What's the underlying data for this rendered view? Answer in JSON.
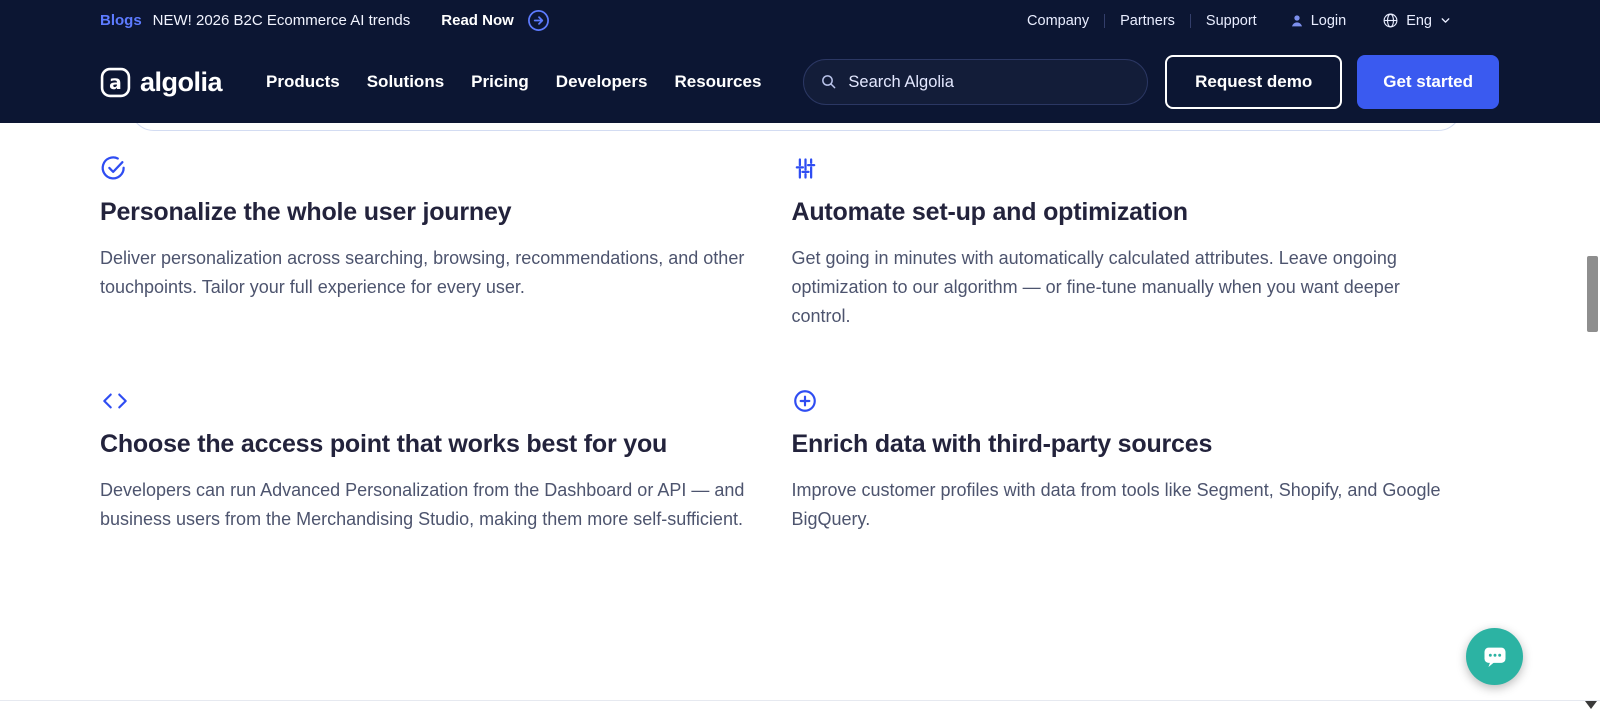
{
  "announcement": {
    "blogs_label": "Blogs",
    "text": "NEW! 2026 B2C Ecommerce AI trends",
    "read_now_label": "Read Now",
    "links": [
      "Company",
      "Partners",
      "Support"
    ],
    "login_label": "Login",
    "language": "Eng"
  },
  "navbar": {
    "brand": "algolia",
    "items": [
      "Products",
      "Solutions",
      "Pricing",
      "Developers",
      "Resources"
    ],
    "search_placeholder": "Search Algolia",
    "request_demo": "Request demo",
    "get_started": "Get started"
  },
  "features": [
    {
      "icon": "check-circle-icon",
      "title": "Personalize the whole user journey",
      "body": "Deliver personalization across searching, browsing, recommendations, and other touchpoints. Tailor your full experience for every user."
    },
    {
      "icon": "sliders-icon",
      "title": "Automate set-up and optimization",
      "body": "Get going in minutes with automatically calculated attributes. Leave ongoing optimization to our algorithm — or fine-tune manually when you want deeper control."
    },
    {
      "icon": "code-icon",
      "title": "Choose the access point that works best for you",
      "body": "Developers can run Advanced Personalization from the Dashboard or API — and business users from the Merchandising Studio, making them more self-sufficient."
    },
    {
      "icon": "plus-circle-icon",
      "title": "Enrich data with third-party sources",
      "body": "Improve customer profiles with data from tools like Segment, Shopify, and Google BigQuery."
    }
  ],
  "icons": {
    "arrow-circle-icon": "circled right arrow",
    "user-icon": "person silhouette",
    "globe-icon": "globe",
    "chevron-down-icon": "▾",
    "search-icon": "magnifier",
    "algolia-mark-icon": "rounded square with letter a",
    "chat-icon": "speech bubble with dots",
    "check-circle-icon": "open circle with check",
    "sliders-icon": "vertical adjustment sliders",
    "code-icon": "angle brackets",
    "plus-circle-icon": "circle with plus"
  },
  "colors": {
    "navy": "#0c1633",
    "accent_blue": "#3a5af0",
    "icon_blue": "#2f4df2",
    "link_blue": "#5d7bff",
    "chat_teal": "#2cb3a3",
    "heading": "#23233c",
    "body_text": "#4d546e"
  }
}
